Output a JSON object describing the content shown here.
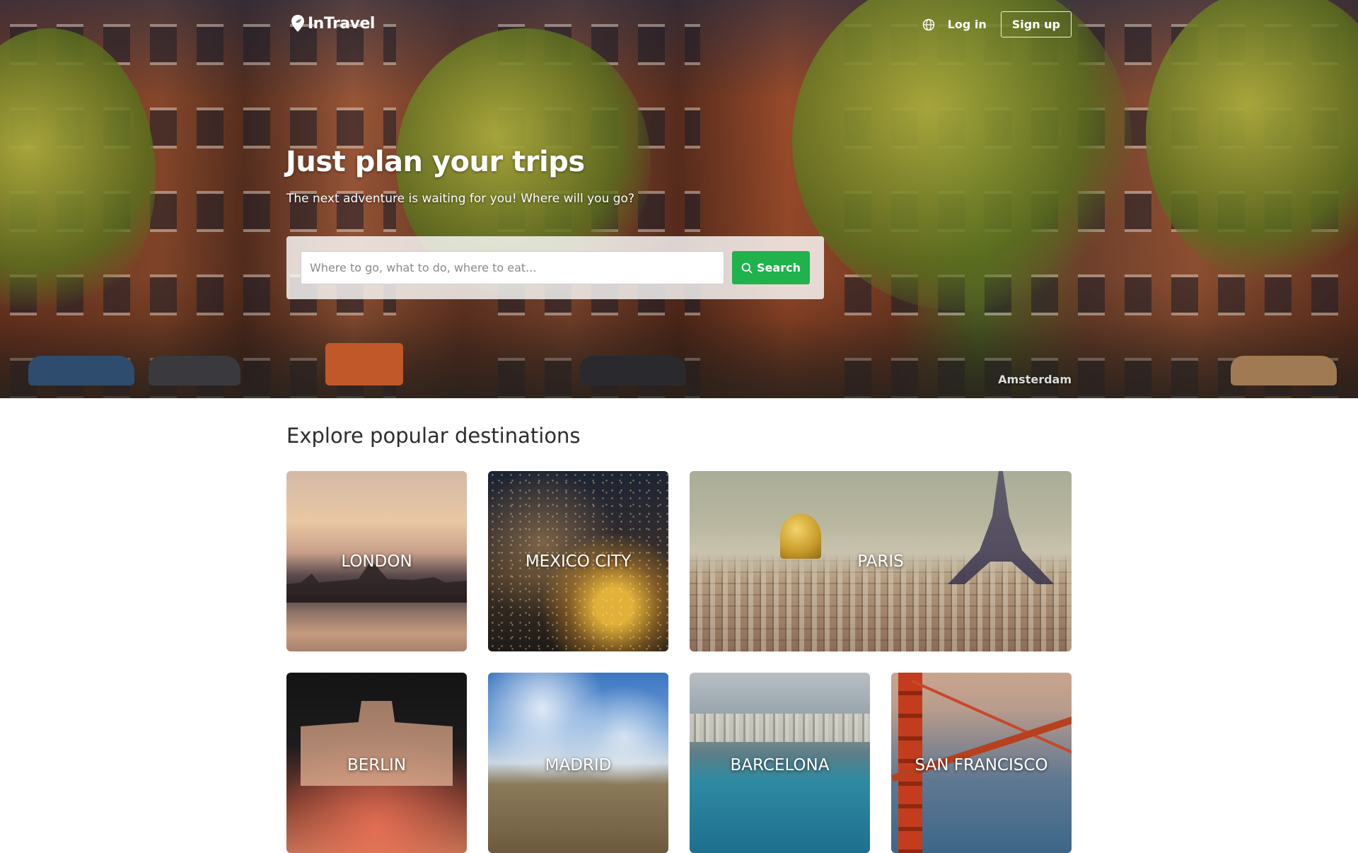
{
  "brand": {
    "name": "InTravel",
    "logo_icon": "map-pin-leaf-icon"
  },
  "header": {
    "language_icon": "globe-icon",
    "login_label": "Log in",
    "signup_label": "Sign up"
  },
  "hero": {
    "title": "Just plan your trips",
    "subtitle": "The next adventure is waiting for you! Where will you go?",
    "caption": "Amsterdam"
  },
  "search": {
    "placeholder": "Where to go, what to do, where to eat...",
    "value": "",
    "button_label": "Search",
    "button_icon": "search-icon",
    "button_color": "#1fb24d"
  },
  "destinations": {
    "heading": "Explore popular destinations",
    "cards": [
      {
        "label": "LONDON"
      },
      {
        "label": "MEXICO CITY"
      },
      {
        "label": "PARIS"
      },
      {
        "label": "BERLIN"
      },
      {
        "label": "MADRID"
      },
      {
        "label": "BARCELONA"
      },
      {
        "label": "SAN FRANCISCO"
      }
    ]
  }
}
